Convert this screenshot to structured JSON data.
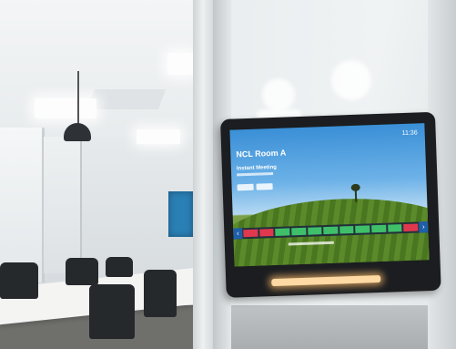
{
  "panel": {
    "room_name": "NCL Room A",
    "time": "11:36",
    "meeting_label": "Instant Meeting"
  },
  "colors": {
    "slot_free": "#3fbf6a",
    "slot_busy": "#e0384f",
    "nav_arrow": "#1f5fa8",
    "led_strip": "#ffd9a3"
  },
  "timeline_slots": [
    "busy",
    "busy",
    "free",
    "free",
    "free",
    "free",
    "free",
    "free",
    "free",
    "free",
    "busy"
  ]
}
